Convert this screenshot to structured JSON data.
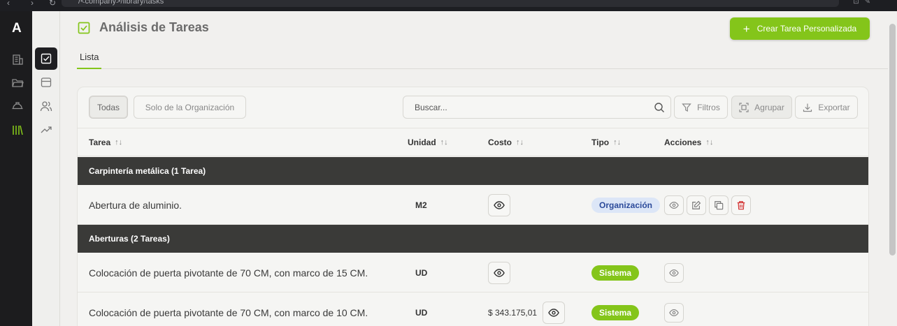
{
  "browser": {
    "url": "/<company>/library/tasks"
  },
  "rail": {
    "logo": "A"
  },
  "page": {
    "title": "Análisis de Tareas",
    "create_button": "Crear Tarea Personalizada"
  },
  "tabs": [
    {
      "label": "Lista",
      "active": true
    }
  ],
  "toolbar": {
    "filter_all": "Todas",
    "filter_org": "Solo de la Organización",
    "search_placeholder": "Buscar...",
    "filters": "Filtros",
    "group": "Agrupar",
    "export": "Exportar"
  },
  "table": {
    "columns": [
      "Tarea",
      "Unidad",
      "Costo",
      "Tipo",
      "Acciones"
    ],
    "groups": [
      {
        "label": "Carpintería metálica (1 Tarea)",
        "rows": [
          {
            "task": "Abertura de aluminio.",
            "unit": "M2",
            "cost": "",
            "type": "Organización"
          }
        ]
      },
      {
        "label": "Aberturas (2 Tareas)",
        "rows": [
          {
            "task": "Colocación de puerta pivotante de 70 CM, con marco de 15 CM.",
            "unit": "UD",
            "cost": "",
            "type": "Sistema"
          },
          {
            "task": "Colocación de puerta pivotante de 70 CM, con marco de 10 CM.",
            "unit": "UD",
            "cost": "$ 343.175,01",
            "type": "Sistema"
          }
        ]
      }
    ]
  },
  "colors": {
    "accent": "#84c51a",
    "group_bg": "#3a3a38",
    "org_badge_bg": "#dce6f7",
    "delete": "#d22b2b"
  }
}
